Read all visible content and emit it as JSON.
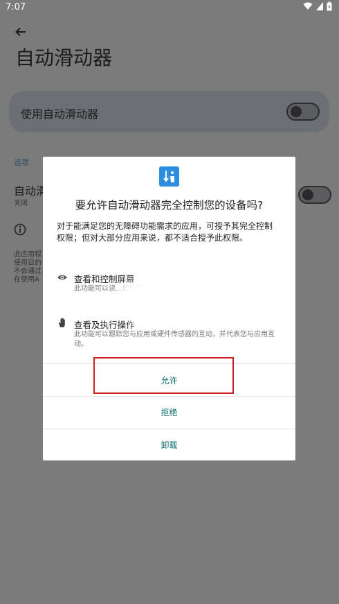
{
  "status_bar": {
    "time": "7:07"
  },
  "header": {
    "title": "自动滑动器"
  },
  "master_switch": {
    "label": "使用自动滑动器",
    "state": "off"
  },
  "options": {
    "section_label": "选项",
    "pref_title": "自动滑",
    "pref_summary": "关闭",
    "info_lines": [
      "此应用程",
      "使用目的",
      "不会通过",
      "在使用A"
    ]
  },
  "dialog": {
    "title": "要允许自动滑动器完全控制您的设备吗?",
    "description": "对于能满足您的无障碍功能需求的应用，可授予其完全控制权限；但对大部分应用来说，都不适合授予此权限。",
    "permissions": [
      {
        "icon": "eye-icon",
        "title": "查看和控制屏幕",
        "desc": "此功能可以读...他应用上层显示内容。"
      },
      {
        "icon": "hand-icon",
        "title": "查看及执行操作",
        "desc": "此功能可以跟踪您与应用或硬件传感器的互动，并代表您与应用互动。"
      }
    ],
    "buttons": {
      "allow": "允许",
      "deny": "拒绝",
      "uninstall": "卸载"
    }
  },
  "colors": {
    "accent": "#0d6e73",
    "highlight": "#cc1f1f",
    "scrim": "#7b7b7b"
  }
}
